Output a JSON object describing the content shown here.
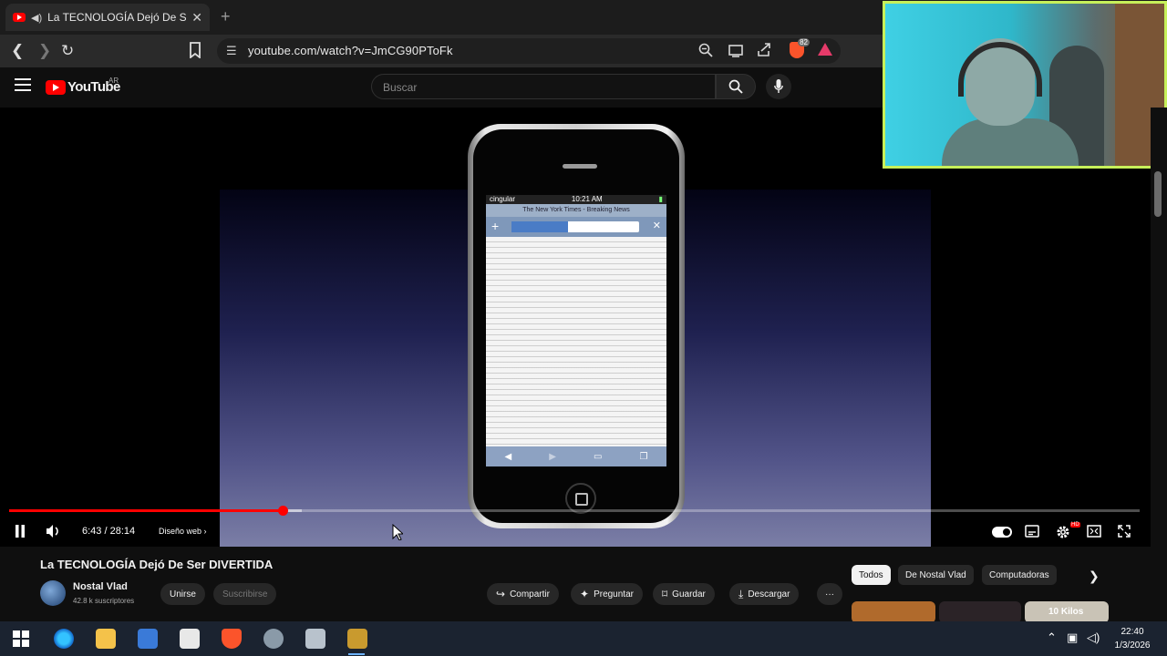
{
  "browser": {
    "tab_title": "La TECNOLOGÍA Dejó De Ser DIVERTIDA",
    "tab_close": "✕",
    "new_tab": "+",
    "url": "youtube.com/watch?v=JmCG90PToFk",
    "shield_badge": "82"
  },
  "youtube": {
    "logo_text": "YouTube",
    "country": "AR",
    "search_placeholder": "Buscar"
  },
  "player": {
    "time": "6:43 / 28:14",
    "chapter": "Diseño web",
    "chapter_arrow": "›",
    "progress_played": 0.242,
    "progress_buffered": 0.259,
    "hd_badge": "HD"
  },
  "phone_screen": {
    "carrier": "cingular",
    "clock": "10:21 AM",
    "page_title": "The New York Times - Breaking News"
  },
  "video_info": {
    "title": "La TECNOLOGÍA Dejó De Ser DIVERTIDA",
    "channel": "Nostal Vlad",
    "subscribers": "42.8 k suscriptores",
    "join_label": "Unirse",
    "subscribe_label": "Suscribirse",
    "share_label": "Compartir",
    "ask_label": "Preguntar",
    "save_label": "Guardar",
    "download_label": "Descargar",
    "more_label": "···"
  },
  "chips": [
    "Todos",
    "De Nostal Vlad",
    "Computadoras"
  ],
  "thumbnail_text": "10 Kilos",
  "taskbar": {
    "time": "22:40",
    "date": "1/3/2026"
  }
}
